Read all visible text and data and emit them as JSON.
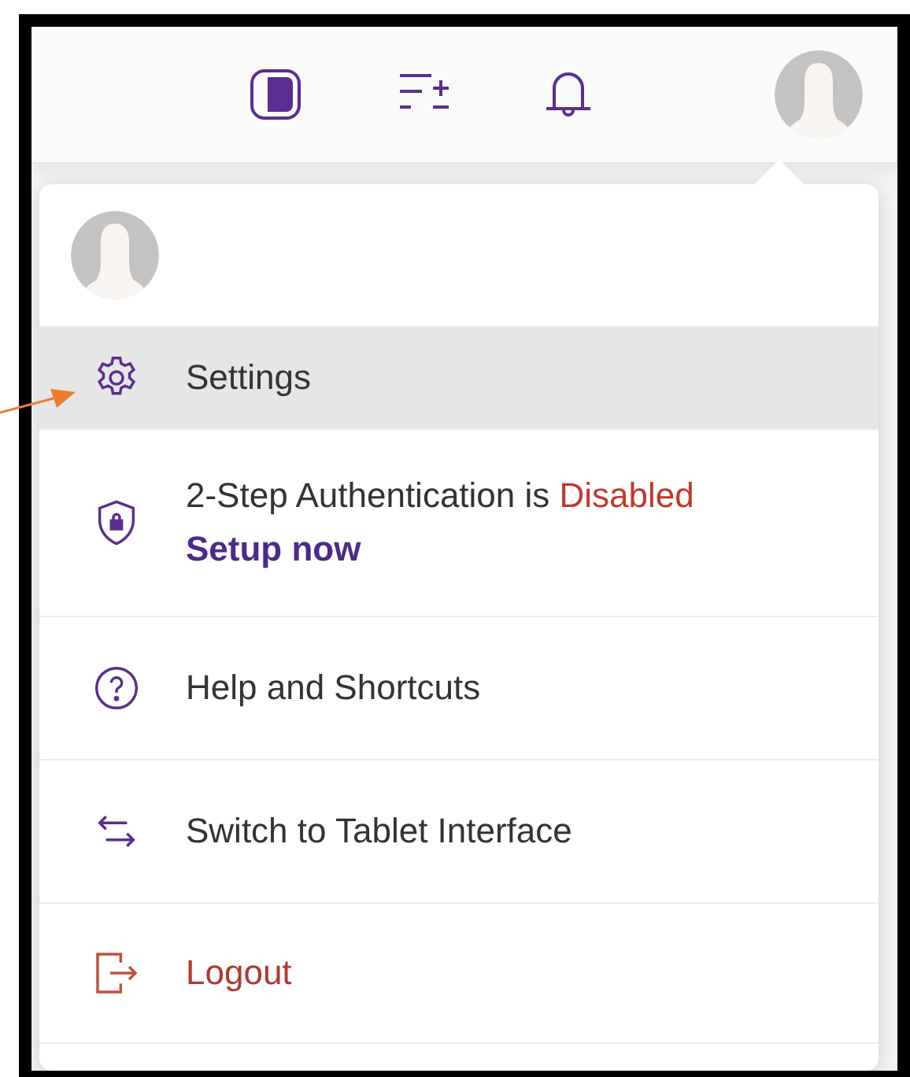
{
  "annotation": {
    "kind": "arrow"
  },
  "menu": {
    "items": [
      {
        "kind": "plain",
        "label": "Settings",
        "selected": true
      },
      {
        "kind": "notice",
        "label": "2-Step Authentication is **Disabled**",
        "action": "Setup now",
        "selected": false
      },
      {
        "kind": "plain",
        "label": "Help and Shortcuts",
        "selected": false
      },
      {
        "kind": "plain",
        "label": "Switch to Tablet Interface",
        "selected": false
      },
      {
        "kind": "danger",
        "label": "Logout",
        "selected": false
      }
    ]
  }
}
